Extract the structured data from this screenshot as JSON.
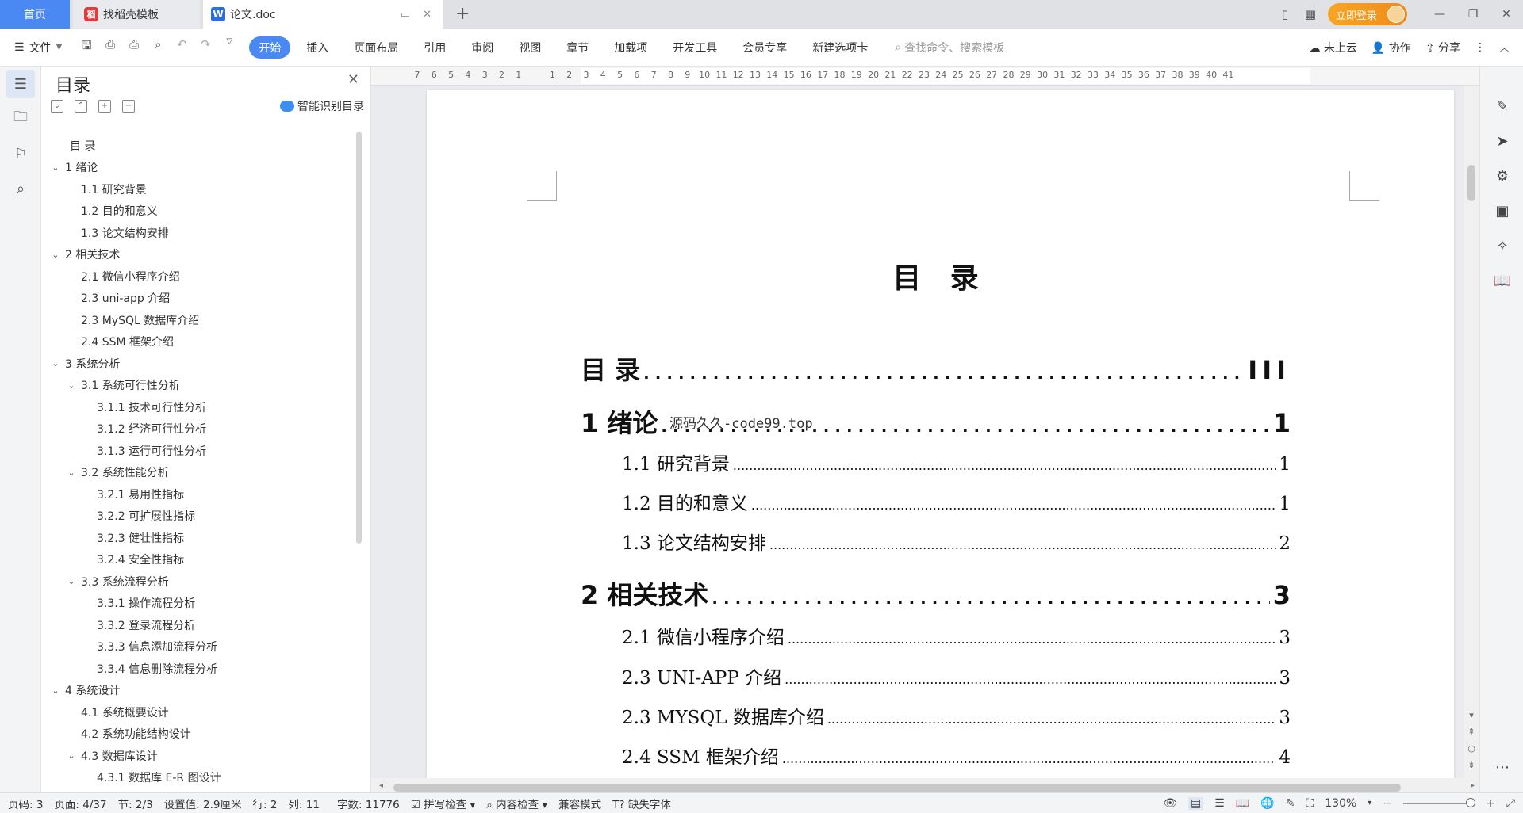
{
  "titlebar": {
    "tabs": [
      {
        "label": "首页"
      },
      {
        "label": "找稻壳模板"
      },
      {
        "label": "论文.doc"
      }
    ],
    "login_label": "立即登录"
  },
  "menubar": {
    "file_label": "文件",
    "items": [
      "开始",
      "插入",
      "页面布局",
      "引用",
      "审阅",
      "视图",
      "章节",
      "加载项",
      "开发工具",
      "会员专享",
      "新建选项卡"
    ],
    "search_placeholder": "查找命令、搜索模板",
    "cloud_label": "未上云",
    "collab_label": "协作",
    "share_label": "分享"
  },
  "toc_panel": {
    "title": "目录",
    "smart_label": "智能识别目录",
    "items": [
      {
        "text": "目  录",
        "level": 0,
        "caret": ""
      },
      {
        "text": "1  绪论",
        "level": 0,
        "caret": "v"
      },
      {
        "text": "1.1  研究背景",
        "level": 1,
        "caret": ""
      },
      {
        "text": "1.2  目的和意义",
        "level": 1,
        "caret": ""
      },
      {
        "text": "1.3  论文结构安排",
        "level": 1,
        "caret": ""
      },
      {
        "text": "2  相关技术",
        "level": 0,
        "caret": "v"
      },
      {
        "text": "2.1  微信小程序介绍",
        "level": 1,
        "caret": ""
      },
      {
        "text": "2.3 uni-app 介绍",
        "level": 1,
        "caret": ""
      },
      {
        "text": "2.3 MySQL 数据库介绍",
        "level": 1,
        "caret": ""
      },
      {
        "text": "2.4 SSM 框架介绍",
        "level": 1,
        "caret": ""
      },
      {
        "text": "3  系统分析",
        "level": 0,
        "caret": "v"
      },
      {
        "text": "3.1  系统可行性分析",
        "level": 1,
        "caret": "v"
      },
      {
        "text": "3.1.1  技术可行性分析",
        "level": 2,
        "caret": ""
      },
      {
        "text": "3.1.2  经济可行性分析",
        "level": 2,
        "caret": ""
      },
      {
        "text": "3.1.3  运行可行性分析",
        "level": 2,
        "caret": ""
      },
      {
        "text": "3.2  系统性能分析",
        "level": 1,
        "caret": "v"
      },
      {
        "text": "3.2.1  易用性指标",
        "level": 2,
        "caret": ""
      },
      {
        "text": "3.2.2  可扩展性指标",
        "level": 2,
        "caret": ""
      },
      {
        "text": "3.2.3  健壮性指标",
        "level": 2,
        "caret": ""
      },
      {
        "text": "3.2.4  安全性指标",
        "level": 2,
        "caret": ""
      },
      {
        "text": "3.3  系统流程分析",
        "level": 1,
        "caret": "v"
      },
      {
        "text": "3.3.1  操作流程分析",
        "level": 2,
        "caret": ""
      },
      {
        "text": "3.3.2  登录流程分析",
        "level": 2,
        "caret": ""
      },
      {
        "text": "3.3.3  信息添加流程分析",
        "level": 2,
        "caret": ""
      },
      {
        "text": "3.3.4  信息删除流程分析",
        "level": 2,
        "caret": ""
      },
      {
        "text": "4  系统设计",
        "level": 0,
        "caret": "v"
      },
      {
        "text": "4.1  系统概要设计",
        "level": 1,
        "caret": ""
      },
      {
        "text": "4.2  系统功能结构设计",
        "level": 1,
        "caret": ""
      },
      {
        "text": "4.3  数据库设计",
        "level": 1,
        "caret": "v"
      },
      {
        "text": "4.3.1  数据库 E-R 图设计",
        "level": 2,
        "caret": ""
      }
    ]
  },
  "ruler": {
    "numbers": [
      "7",
      "6",
      "5",
      "4",
      "3",
      "2",
      "1",
      "",
      "1",
      "2",
      "3",
      "4",
      "5",
      "6",
      "7",
      "8",
      "9",
      "10",
      "11",
      "12",
      "13",
      "14",
      "15",
      "16",
      "17",
      "18",
      "19",
      "20",
      "21",
      "22",
      "23",
      "24",
      "25",
      "26",
      "27",
      "28",
      "29",
      "30",
      "31",
      "32",
      "33",
      "34",
      "35",
      "36",
      "37",
      "38",
      "39",
      "40",
      "41"
    ]
  },
  "document": {
    "heading": "目  录",
    "watermark": "源码久久-code99.top",
    "entries": [
      {
        "title": "目  录",
        "page": "III",
        "level": 1
      },
      {
        "title": "1  绪论",
        "page": "1",
        "level": 1
      },
      {
        "title": "1.1  研究背景",
        "page": "1",
        "level": 2
      },
      {
        "title": "1.2  目的和意义",
        "page": "1",
        "level": 2
      },
      {
        "title": "1.3  论文结构安排",
        "page": "2",
        "level": 2
      },
      {
        "title": "2  相关技术",
        "page": "3",
        "level": 1
      },
      {
        "title": "2.1  微信小程序介绍",
        "page": "3",
        "level": 2
      },
      {
        "title": "2.3 UNI-APP 介绍",
        "page": "3",
        "level": 2
      },
      {
        "title": "2.3 MYSQL 数据库介绍",
        "page": "3",
        "level": 2
      },
      {
        "title": "2.4 SSM 框架介绍",
        "page": "4",
        "level": 2
      }
    ]
  },
  "statusbar": {
    "page_code": "页码: 3",
    "page": "页面: 4/37",
    "section": "节: 2/3",
    "setting": "设置值: 2.9厘米",
    "row": "行: 2",
    "col": "列: 11",
    "word_count": "字数: 11776",
    "spell_check": "拼写检查",
    "content_check": "内容检查",
    "compat_mode": "兼容模式",
    "missing_font": "缺失字体",
    "zoom": "130%",
    "zoom_level": 0.5
  }
}
